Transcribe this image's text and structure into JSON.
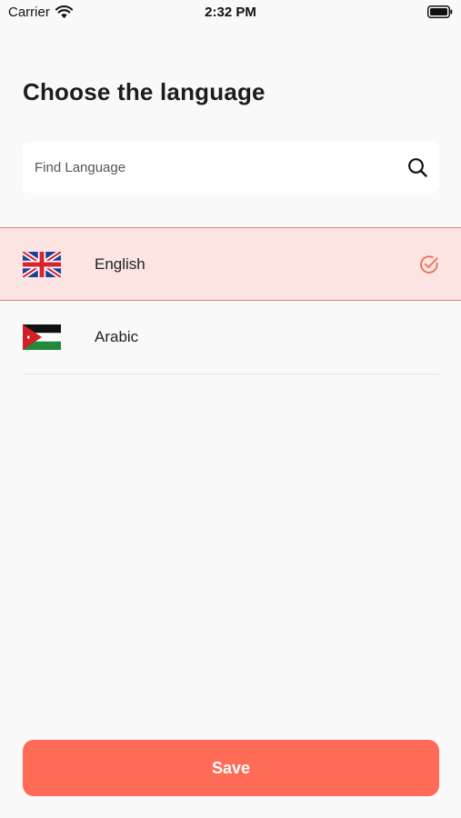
{
  "status_bar": {
    "carrier": "Carrier",
    "time": "2:32 PM",
    "icons": [
      "wifi-icon",
      "battery-icon"
    ]
  },
  "page": {
    "title": "Choose the language"
  },
  "search": {
    "placeholder": "Find Language",
    "value": "",
    "icon": "search-icon"
  },
  "languages": [
    {
      "label": "English",
      "flag": "uk-flag-icon",
      "selected": true
    },
    {
      "label": "Arabic",
      "flag": "jordan-flag-icon",
      "selected": false
    }
  ],
  "selected_check_icon": "check-circle-icon",
  "save_button": {
    "label": "Save"
  },
  "colors": {
    "accent": "#ff6b57",
    "selected_row_bg": "#fbe4e1",
    "selected_row_border": "#f07b68",
    "background": "#f9f9f9"
  }
}
